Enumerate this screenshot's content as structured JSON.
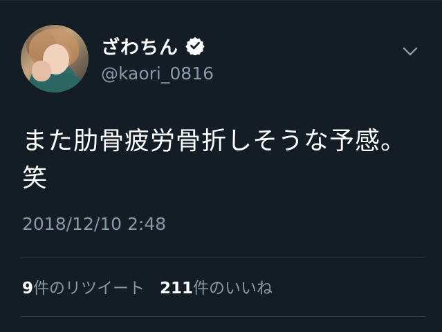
{
  "tweet": {
    "display_name": "ざわちん",
    "handle": "@kaori_0816",
    "text": "また肋骨疲労骨折しそうな予感。笑",
    "timestamp": "2018/12/10 2:48",
    "retweet_count": "9",
    "retweet_label": "件のリツイート",
    "like_count": "211",
    "like_label": "件のいいね"
  },
  "colors": {
    "background": "#141d26",
    "text_primary": "#ffffff",
    "text_secondary": "#8899a6",
    "divider": "#2a3744"
  },
  "icons": {
    "verified": "verified-badge-icon",
    "menu": "chevron-down-icon"
  }
}
